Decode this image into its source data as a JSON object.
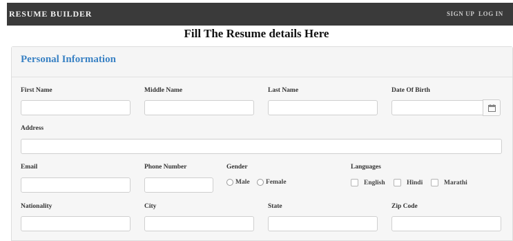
{
  "nav": {
    "brand": "RESUME BUILDER",
    "sign_up": "SIGN UP",
    "log_in": "LOG IN"
  },
  "heading": "Fill The Resume details Here",
  "panel": {
    "title": "Personal Information"
  },
  "fields": {
    "first_name": {
      "label": "First Name",
      "value": ""
    },
    "middle_name": {
      "label": "Middle Name",
      "value": ""
    },
    "last_name": {
      "label": "Last Name",
      "value": ""
    },
    "dob": {
      "label": "Date Of Birth",
      "value": "",
      "icon": "calendar-icon"
    },
    "address": {
      "label": "Address",
      "value": ""
    },
    "email": {
      "label": "Email",
      "value": ""
    },
    "phone": {
      "label": "Phone Number",
      "value": ""
    },
    "gender": {
      "label": "Gender",
      "options": [
        "Male",
        "Female"
      ]
    },
    "languages": {
      "label": "Languages",
      "options": [
        "English",
        "Hindi",
        "Marathi"
      ]
    },
    "nationality": {
      "label": "Nationality",
      "value": ""
    },
    "city": {
      "label": "City",
      "value": ""
    },
    "state": {
      "label": "State",
      "value": ""
    },
    "zip": {
      "label": "Zip Code",
      "value": ""
    }
  },
  "colors": {
    "topbar": "#3a3a3a",
    "panel_title": "#3a82c4",
    "panel_bg": "#f6f6f6"
  }
}
